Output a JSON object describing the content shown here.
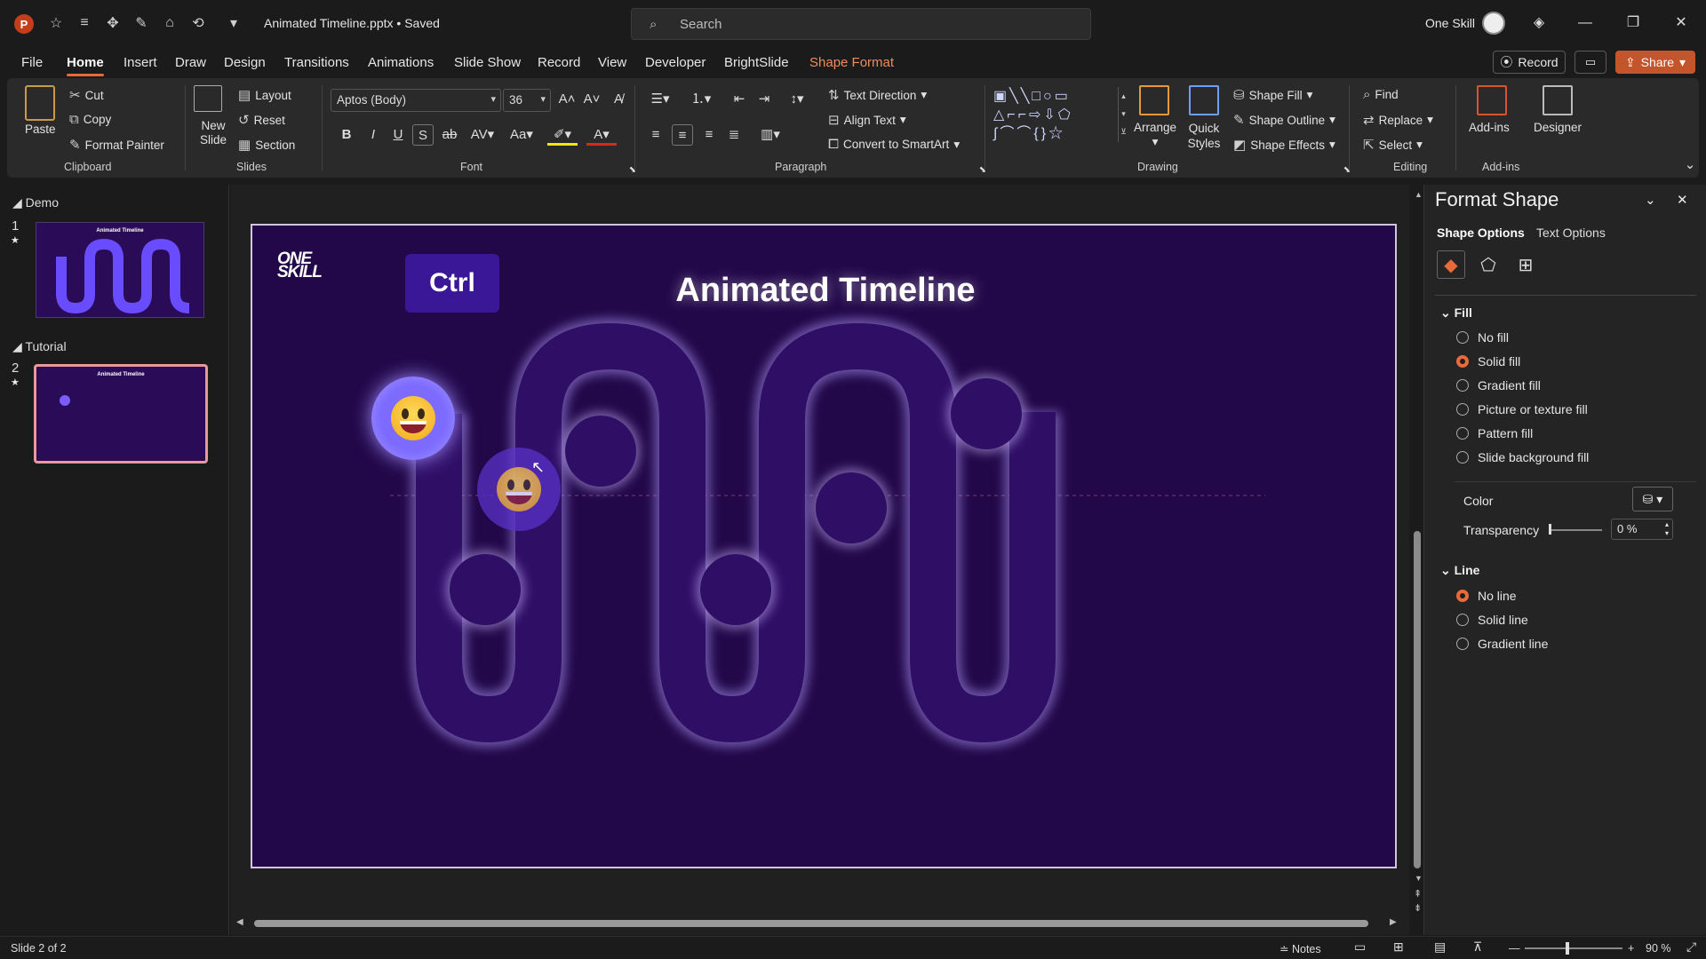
{
  "titlebar": {
    "app_icon": "P",
    "doc_title": "Animated Timeline.pptx • Saved",
    "search_placeholder": "Search",
    "user_name": "One Skill",
    "icons": [
      "autosave-icon",
      "touch-mode-icon",
      "draw-icon",
      "customize-icon",
      "present-icon",
      "undo-icon",
      "more-icon"
    ]
  },
  "menu": {
    "items": [
      "File",
      "Home",
      "Insert",
      "Draw",
      "Design",
      "Transitions",
      "Animations",
      "Slide Show",
      "Record",
      "View",
      "Developer",
      "BrightSlide",
      "Shape Format"
    ],
    "active": "Home",
    "record_label": "Record",
    "share_label": "Share"
  },
  "ribbon": {
    "clipboard": {
      "paste": "Paste",
      "cut": "Cut",
      "copy": "Copy",
      "format_painter": "Format Painter",
      "label": "Clipboard"
    },
    "slides": {
      "new_slide": "New Slide",
      "layout": "Layout",
      "reset": "Reset",
      "section": "Section",
      "label": "Slides"
    },
    "font": {
      "name": "Aptos (Body)",
      "size": "36",
      "label": "Font"
    },
    "paragraph": {
      "text_direction": "Text Direction",
      "align_text": "Align Text",
      "convert": "Convert to SmartArt",
      "label": "Paragraph"
    },
    "drawing": {
      "arrange": "Arrange",
      "quick_styles": "Quick Styles",
      "shape_fill": "Shape Fill",
      "shape_outline": "Shape Outline",
      "shape_effects": "Shape Effects",
      "label": "Drawing"
    },
    "editing": {
      "find": "Find",
      "replace": "Replace",
      "select": "Select",
      "label": "Editing"
    },
    "addins": {
      "addins": "Add-ins",
      "designer": "Designer",
      "label": "Add-ins"
    }
  },
  "slides_panel": {
    "sections": [
      {
        "name": "Demo",
        "slide_number": "1"
      },
      {
        "name": "Tutorial",
        "slide_number": "2"
      }
    ],
    "thumb_title": "Animated Timeline"
  },
  "slide": {
    "title": "Animated Timeline",
    "ctrl_key": "Ctrl",
    "logo_line1": "ONE",
    "logo_line2": "SKILL"
  },
  "format_panel": {
    "title": "Format Shape",
    "tabs": [
      "Shape Options",
      "Text Options"
    ],
    "fill_section": "Fill",
    "fill_options": [
      "No fill",
      "Solid fill",
      "Gradient fill",
      "Picture or texture fill",
      "Pattern fill",
      "Slide background fill"
    ],
    "fill_selected": "Solid fill",
    "color_label": "Color",
    "transparency_label": "Transparency",
    "transparency_value": "0 %",
    "line_section": "Line",
    "line_options": [
      "No line",
      "Solid line",
      "Gradient line"
    ],
    "line_selected": "No line"
  },
  "status": {
    "slide_info": "Slide 2 of 2",
    "notes": "Notes",
    "zoom": "90 %"
  },
  "colors": {
    "accent": "#e46a3d",
    "slide_bg": "#220849",
    "track": "#3c1a78"
  }
}
